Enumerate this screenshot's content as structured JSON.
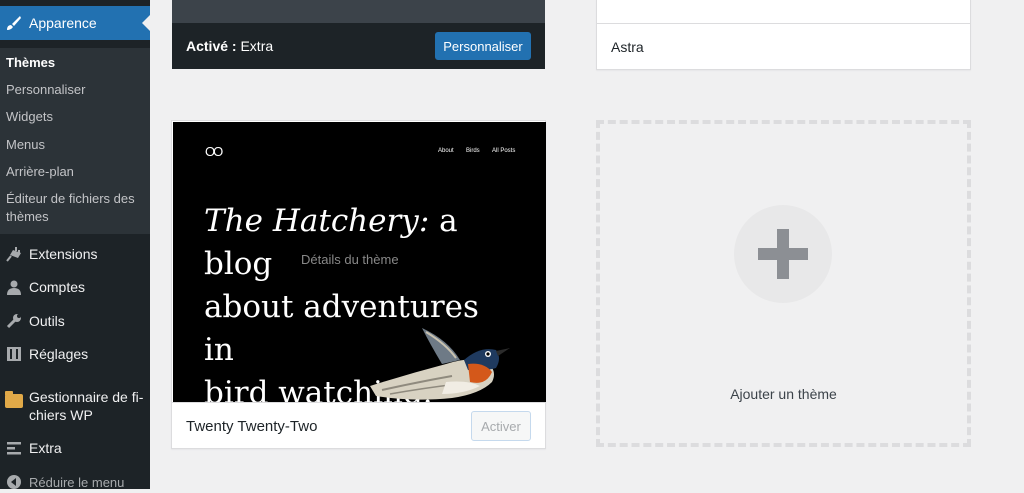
{
  "sidebar": {
    "current": "Apparence",
    "submenu": [
      "Thèmes",
      "Personnaliser",
      "Widgets",
      "Menus",
      "Arrière-plan",
      "Éditeur de fichiers des",
      "thèmes"
    ],
    "items": [
      "Extensions",
      "Comptes",
      "Outils",
      "Réglages",
      "Gestionnaire de fi-",
      "chiers WP",
      "Extra",
      "Réduire le menu"
    ]
  },
  "active_theme": {
    "label_strong": "Activé :",
    "label_name": " Extra",
    "customize_button": "Personnaliser"
  },
  "astra": {
    "name": "Astra"
  },
  "twentytwentytwo": {
    "name": "Twenty Twenty-Two",
    "activate_button": "Activer",
    "details_overlay": "Détails du thème",
    "screenshot": {
      "logo": "OO",
      "nav": [
        "About",
        "Birds",
        "All Posts"
      ],
      "headline_italic": "The Hatchery:",
      "headline_rest_1": " a blog",
      "headline_line_2": "about adventures in",
      "headline_line_3": "bird watching."
    }
  },
  "add_theme": {
    "label": "Ajouter un thème"
  }
}
